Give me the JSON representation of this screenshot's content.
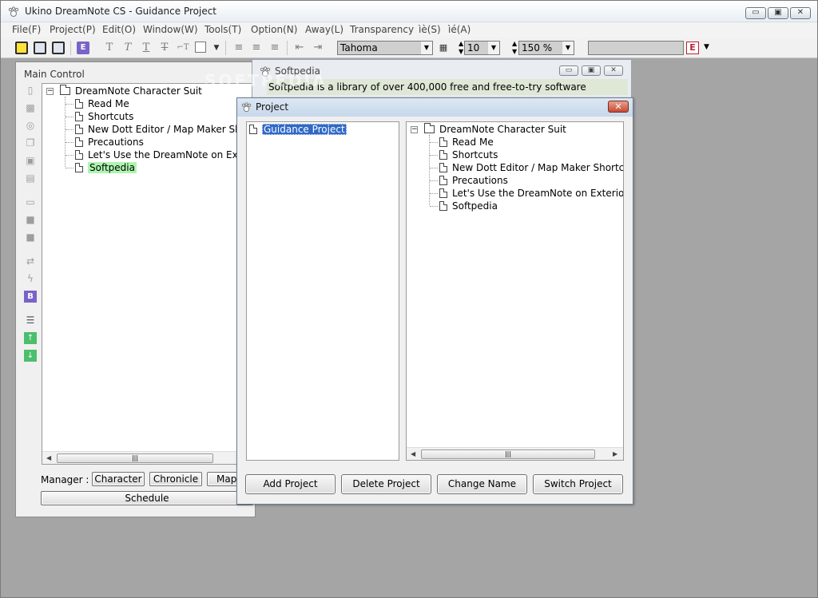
{
  "window": {
    "title": "Ukino DreamNote CS - Guidance Project",
    "controls": {
      "minimize": "▭",
      "maximize": "▣",
      "close": "✕"
    }
  },
  "menu": [
    "File(F)",
    "Project(P)",
    "Edit(O)",
    "Window(W)",
    "Tools(T)",
    "Option(N)",
    "Away(L)",
    "Transparency",
    "ìè(S)",
    "ìé(A)"
  ],
  "toolbar": {
    "font": "Tahoma",
    "size": "10",
    "zoom": "150 %",
    "e_button": "E"
  },
  "main_control": {
    "title": "Main Control",
    "tree_root": "DreamNote Character Suit",
    "tree_items": [
      "Read Me",
      "Shortcuts",
      "New Dott Editor / Map Maker Shortcuts",
      "Precautions",
      "Let's Use the DreamNote on Exterior Computer",
      "Softpedia"
    ],
    "manager_label": "Manager :",
    "buttons": [
      "Character",
      "Chronicle",
      "Map"
    ],
    "schedule": "Schedule"
  },
  "softpedia_window": {
    "title": "Softpedia",
    "text": "Softpedia is a library of over 400,000 free and free-to-try software"
  },
  "project_dialog": {
    "title": "Project",
    "projects": [
      "Guidance Project"
    ],
    "tree_root": "DreamNote Character Suit",
    "tree_items": [
      "Read Me",
      "Shortcuts",
      "New Dott Editor / Map Maker Shortcuts",
      "Precautions",
      "Let's Use the DreamNote on Exterior Computer",
      "Softpedia"
    ],
    "buttons": [
      "Add Project",
      "Delete Project",
      "Change Name",
      "Switch Project"
    ]
  },
  "watermark": "SOFTPEDIA"
}
